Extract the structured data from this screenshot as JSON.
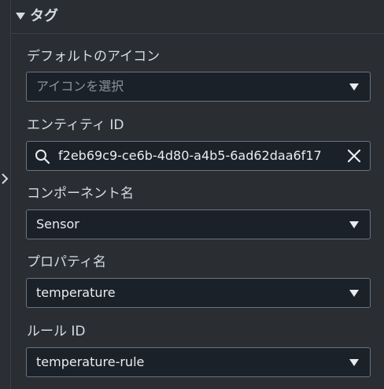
{
  "section": {
    "title": "タグ"
  },
  "fields": {
    "default_icon": {
      "label": "デフォルトのアイコン",
      "placeholder": "アイコンを選択"
    },
    "entity_id": {
      "label": "エンティティ ID",
      "value": "f2eb69c9-ce6b-4d80-a4b5-6ad62daa6f17"
    },
    "component_name": {
      "label": "コンポーネント名",
      "value": "Sensor"
    },
    "property_name": {
      "label": "プロパティ名",
      "value": "temperature"
    },
    "rule_id": {
      "label": "ルール ID",
      "value": "temperature-rule"
    }
  },
  "icons": {
    "header_caret": "caret-down-icon",
    "rail": "chevron-right-icon",
    "search": "search-icon",
    "clear": "close-icon",
    "select": "dropdown-triangle-icon"
  },
  "colors": {
    "background": "#2a2e33",
    "input_background": "#1b2128",
    "input_border": "#6b7380",
    "text": "#d5dbe3",
    "placeholder": "#8a939e"
  }
}
